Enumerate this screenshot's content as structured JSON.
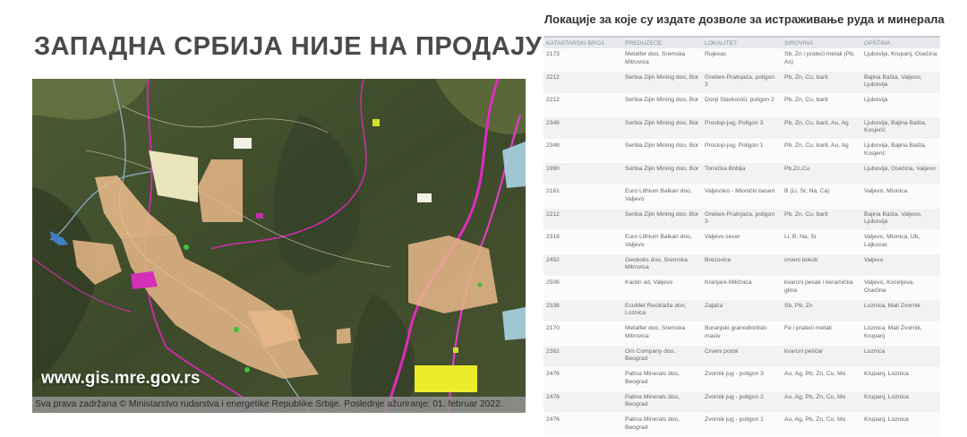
{
  "headline": "ЗАПАДНА СРБИЈА НИЈЕ НА ПРОДАЈУ!",
  "table_title": "Локације за које су издате дозволе за истраживање руда и минерала",
  "map": {
    "url": "www.gis.mre.gov.rs",
    "credit": "Sva prava zadržana © Ministarstvo rudarstva i energetike Republike Srbije. Poslednje ažuriranje: 01. februar 2022."
  },
  "table": {
    "headers": [
      "KATASTARSKI BROJ",
      "PREDUZEĆE",
      "LOKALITET",
      "SIROVINA",
      "OPŠTINA"
    ],
    "rows": [
      [
        "2173",
        "Metalfer doo, Sremska Mitrovica",
        "Rujevac",
        "Sb, Zn i prateći metali (Pb, As)",
        "Ljubovija, Krupanj, Osečina"
      ],
      [
        "2212",
        "Serbia Zijin Mining doo, Bor",
        "Greben-Pratnjača, poligon 3",
        "Pb, Zn, Cu, barit",
        "Bajina Bašta, Valjevo, Ljubovija"
      ],
      [
        "2212",
        "Serbia Zijin Mining doo, Bor",
        "Donji Slavkovići, poligon 2",
        "Pb, Zn, Cu, barit",
        "Ljubovija"
      ],
      [
        "2348",
        "Serbia Zijin Mining doo, Bor",
        "Proslop-jug, Poligon 3",
        "Pb, Zn, Cu, barit, Au, Ag",
        "Ljubovija, Bajina Bašta, Kosjerić"
      ],
      [
        "2348",
        "Serbia Zijin Mining doo, Bor",
        "Proslop-jug, Poligon 1",
        "Pb, Zn, Cu, barit, Au, Ag",
        "Ljubovija, Bajina Bašta, Kosjerić"
      ],
      [
        "1990",
        "Serbia Zijin Mining doo, Bor",
        "Tornička Bobija",
        "Pb,Zn,Cu",
        "Ljubovija, Osečina, Valjevo"
      ],
      [
        "2161",
        "Euro Lithium Balkan doo, Valjevo",
        "Valjevsko - Mionički basen",
        "B (Li, Sr, Na, Ca)",
        "Valjevo, Mionica"
      ],
      [
        "2212",
        "Serbia Zijin Mining doo, Bor",
        "Greben-Pratnjača, poligon 3",
        "Pb, Zn, Cu, barit",
        "Bajina Bašta, Valjevo, Ljubovija"
      ],
      [
        "2318",
        "Euro Lithium Balkan doo, Valjevo",
        "Valjevo sever",
        "Li, B, Na, Sr",
        "Valjevo, Mionica, Ub, Lajkovac"
      ],
      [
        "2452",
        "Geoboks doo, Sremska Mitrovica",
        "Brezovice",
        "crveni boksti",
        "Valjevo"
      ],
      [
        "2506",
        "Kaolin ad, Valjevo",
        "Kranjani-Miličnica",
        "kvarcni pesak i keramička glina",
        "Valjevo, Koceljeva, Osečina"
      ],
      [
        "2338",
        "EcoMet Reciklaža doo, Loznica",
        "Zajača",
        "Sb, Pb, Zn",
        "Loznica, Mali Zvornik"
      ],
      [
        "2170",
        "Metalfer doo, Sremska Mitrovica",
        "Boranjski granodioritski masiv",
        "Fe i prateći metali",
        "Loznica, Mali Zvornik, Krupanj"
      ],
      [
        "2382",
        "Om Company doo, Beograd",
        "Crveni potok",
        "kvarcni peščar",
        "Loznica"
      ],
      [
        "2476",
        "Patina Minerals doo, Beograd",
        "Zvornik jug - poligon 3",
        "Au, Ag, Pb, Zn, Cu, Mo",
        "Krupanj, Loznica"
      ],
      [
        "2476",
        "Patina Minerals doo, Beograd",
        "Zvornik jug - poligon 2",
        "Au, Ag, Pb, Zn, Cu, Mo",
        "Krupanj, Loznica"
      ],
      [
        "2476",
        "Patina Minerals doo, Beograd",
        "Zvornik jug - poligon 1",
        "Au, Ag, Pb, Zn, Cu, Mo",
        "Krupanj, Loznica"
      ]
    ]
  }
}
